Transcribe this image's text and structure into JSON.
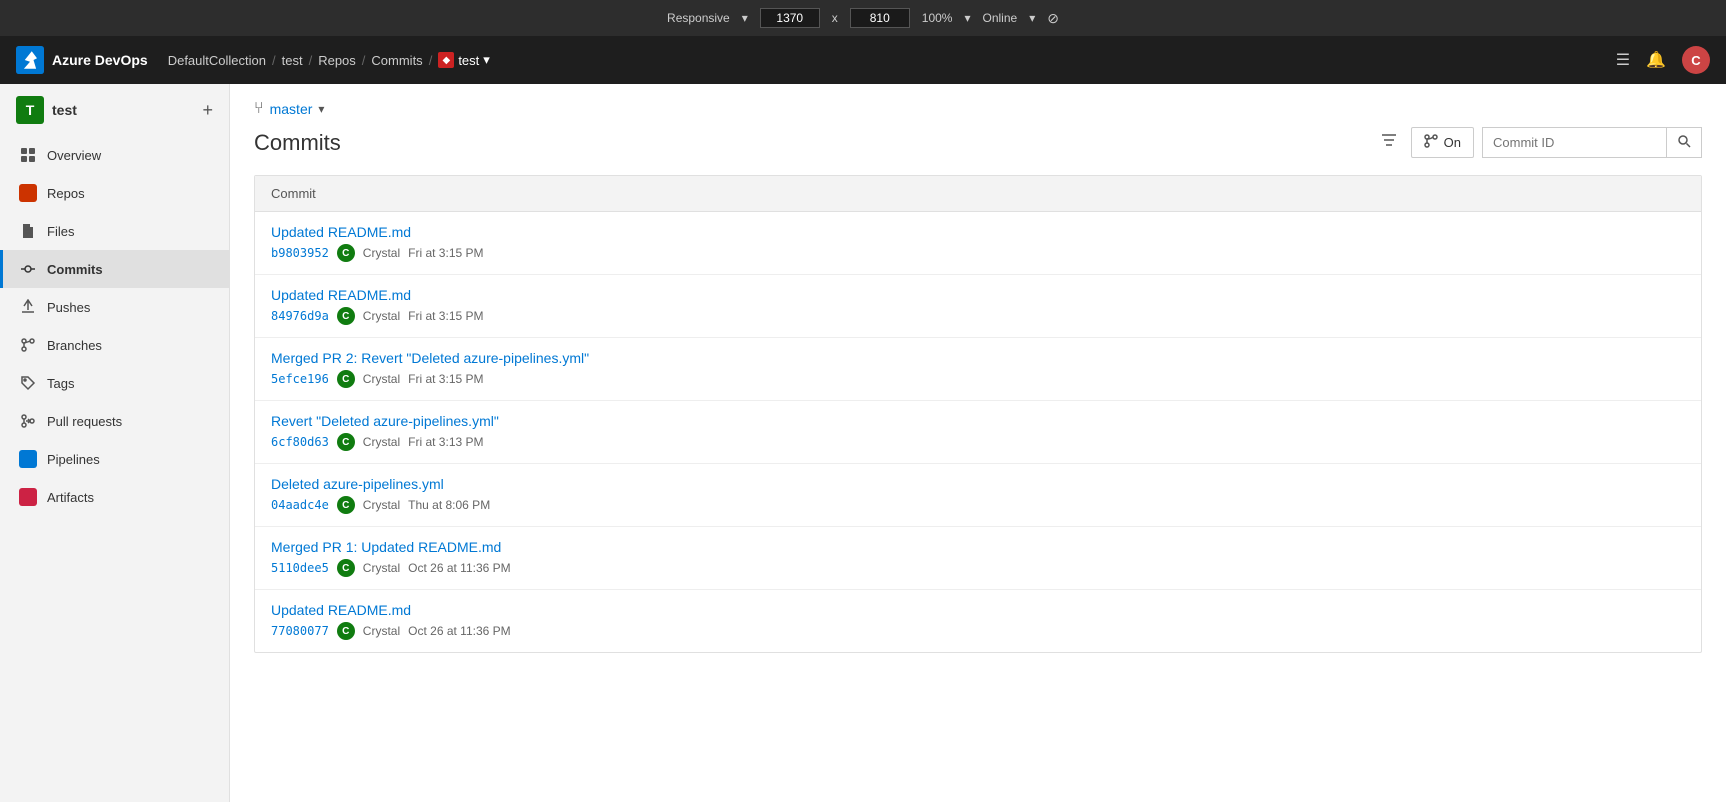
{
  "browser": {
    "responsive_label": "Responsive",
    "width": "1370",
    "x": "x",
    "height": "810",
    "zoom": "100%",
    "status": "Online"
  },
  "topnav": {
    "app_name": "Azure DevOps",
    "breadcrumbs": [
      {
        "label": "DefaultCollection",
        "href": "#"
      },
      {
        "label": "test",
        "href": "#"
      },
      {
        "label": "Repos",
        "href": "#"
      },
      {
        "label": "Commits",
        "href": "#"
      },
      {
        "label": "test",
        "href": "#",
        "has_icon": true
      }
    ],
    "user_initial": "C"
  },
  "sidebar": {
    "project_initial": "T",
    "project_name": "test",
    "add_label": "+",
    "items": [
      {
        "id": "overview",
        "label": "Overview",
        "icon": "home",
        "active": false
      },
      {
        "id": "repos",
        "label": "Repos",
        "icon": "repos",
        "active": false
      },
      {
        "id": "files",
        "label": "Files",
        "icon": "files",
        "active": false
      },
      {
        "id": "commits",
        "label": "Commits",
        "icon": "commits",
        "active": true
      },
      {
        "id": "pushes",
        "label": "Pushes",
        "icon": "pushes",
        "active": false
      },
      {
        "id": "branches",
        "label": "Branches",
        "icon": "branches",
        "active": false
      },
      {
        "id": "tags",
        "label": "Tags",
        "icon": "tags",
        "active": false
      },
      {
        "id": "pull-requests",
        "label": "Pull requests",
        "icon": "pullrequests",
        "active": false
      },
      {
        "id": "pipelines",
        "label": "Pipelines",
        "icon": "pipelines",
        "active": false
      },
      {
        "id": "artifacts",
        "label": "Artifacts",
        "icon": "artifacts",
        "active": false
      }
    ]
  },
  "page": {
    "branch": "master",
    "title": "Commits",
    "on_label": "On",
    "commit_id_placeholder": "Commit ID",
    "table_header": "Commit"
  },
  "commits": [
    {
      "message": "Updated README.md",
      "hash": "b9803952",
      "author": "Crystal",
      "author_initial": "C",
      "timestamp": "Fri at 3:15 PM"
    },
    {
      "message": "Updated README.md",
      "hash": "84976d9a",
      "author": "Crystal",
      "author_initial": "C",
      "timestamp": "Fri at 3:15 PM"
    },
    {
      "message": "Merged PR 2: Revert \"Deleted azure-pipelines.yml\"",
      "hash": "5efce196",
      "author": "Crystal",
      "author_initial": "C",
      "timestamp": "Fri at 3:15 PM"
    },
    {
      "message": "Revert \"Deleted azure-pipelines.yml\"",
      "hash": "6cf80d63",
      "author": "Crystal",
      "author_initial": "C",
      "timestamp": "Fri at 3:13 PM"
    },
    {
      "message": "Deleted azure-pipelines.yml",
      "hash": "04aadc4e",
      "author": "Crystal",
      "author_initial": "C",
      "timestamp": "Thu at 8:06 PM"
    },
    {
      "message": "Merged PR 1: Updated README.md",
      "hash": "5110dee5",
      "author": "Crystal",
      "author_initial": "C",
      "timestamp": "Oct 26 at 11:36 PM"
    },
    {
      "message": "Updated README.md",
      "hash": "77080077",
      "author": "Crystal",
      "author_initial": "C",
      "timestamp": "Oct 26 at 11:36 PM"
    }
  ]
}
